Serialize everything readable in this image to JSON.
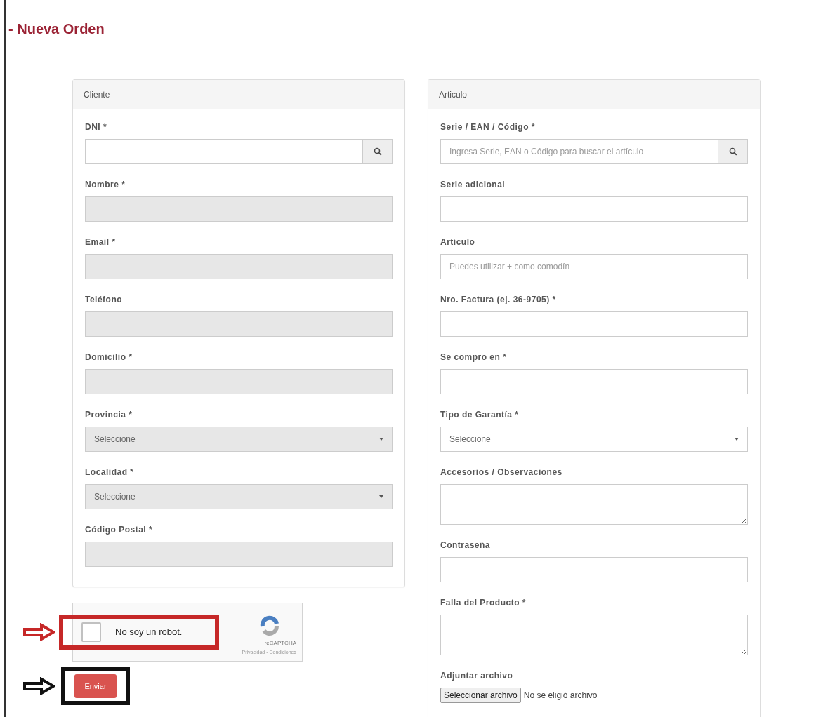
{
  "title": "- Nueva Orden",
  "panels": [
    {
      "heading": "Cliente",
      "fields": [
        {
          "kind": "search",
          "label": "DNI *",
          "disabled": false
        },
        {
          "kind": "text",
          "label": "Nombre *",
          "disabled": true
        },
        {
          "kind": "text",
          "label": "Email *",
          "disabled": true
        },
        {
          "kind": "text",
          "label": "Teléfono",
          "disabled": true
        },
        {
          "kind": "text",
          "label": "Domicilio *",
          "disabled": true
        },
        {
          "kind": "select",
          "label": "Provincia *",
          "value": "Seleccione",
          "disabled": true
        },
        {
          "kind": "select",
          "label": "Localidad *",
          "value": "Seleccione",
          "disabled": true
        },
        {
          "kind": "text",
          "label": "Código Postal *",
          "disabled": true
        }
      ]
    },
    {
      "heading": "Articulo",
      "fields": [
        {
          "kind": "search",
          "label": "Serie / EAN / Código *",
          "placeholder": "Ingresa Serie, EAN o Código para buscar el artículo",
          "disabled": false
        },
        {
          "kind": "text",
          "label": "Serie adicional",
          "disabled": false
        },
        {
          "kind": "text",
          "label": "Artículo",
          "placeholder": "Puedes utilizar + como comodín",
          "disabled": false
        },
        {
          "kind": "text",
          "label": "Nro. Factura (ej. 36-9705) *",
          "disabled": false
        },
        {
          "kind": "text",
          "label": "Se compro en *",
          "disabled": false
        },
        {
          "kind": "select",
          "label": "Tipo de Garantía *",
          "value": "Seleccione",
          "disabled": false
        },
        {
          "kind": "textarea",
          "label": "Accesorios / Observaciones",
          "disabled": false
        },
        {
          "kind": "text",
          "label": "Contraseña",
          "disabled": false
        },
        {
          "kind": "textarea",
          "label": "Falla del Producto *",
          "disabled": false
        },
        {
          "kind": "file",
          "label": "Adjuntar archivo",
          "button": "Seleccionar archivo",
          "status": "No se eligió archivo"
        }
      ]
    }
  ],
  "captcha": {
    "label": "No soy un robot.",
    "checked": false,
    "brand": "reCAPTCHA",
    "links": "Privacidad - Condiciones"
  },
  "submit": "Enviar"
}
